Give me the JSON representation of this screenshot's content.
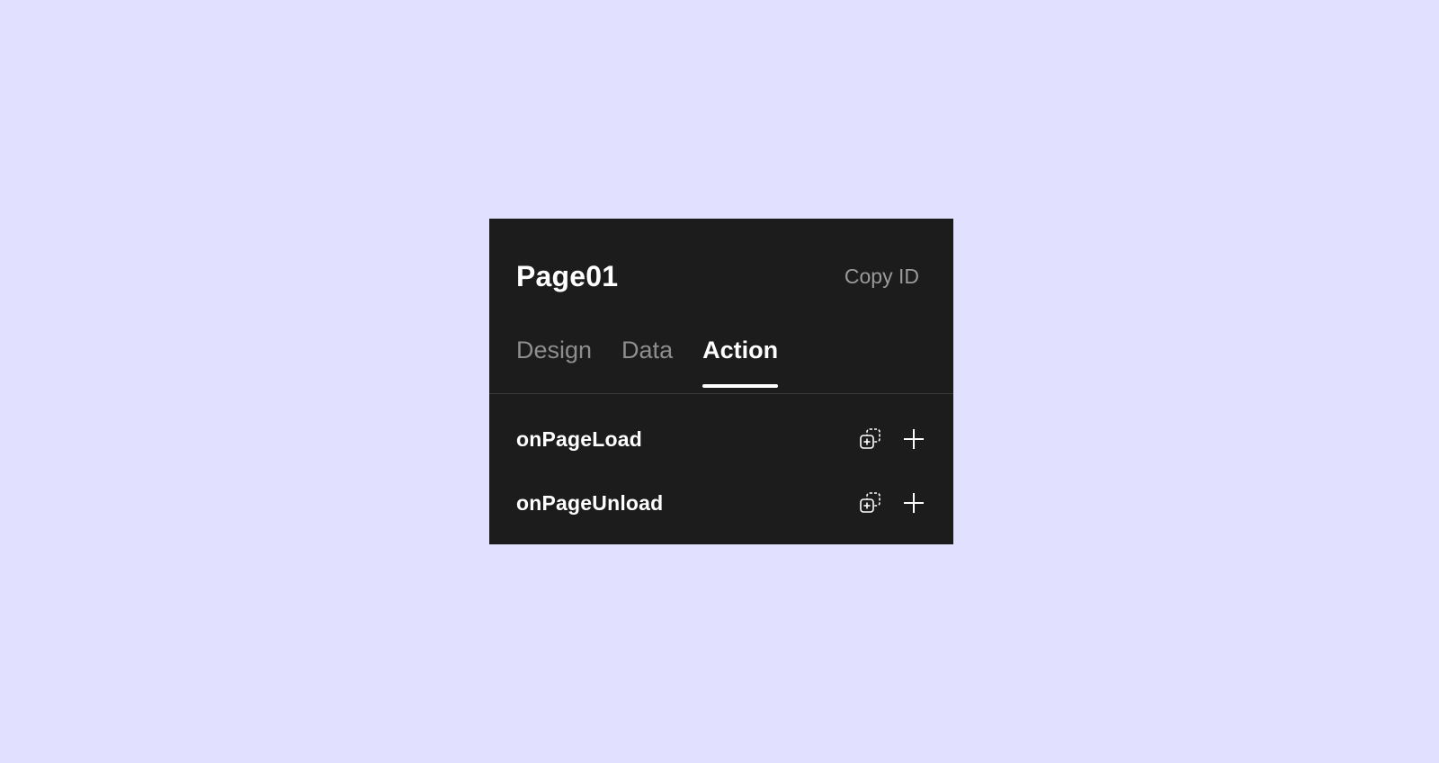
{
  "panel": {
    "title": "Page01",
    "copy_id_label": "Copy ID"
  },
  "tabs": [
    {
      "label": "Design",
      "active": false
    },
    {
      "label": "Data",
      "active": false
    },
    {
      "label": "Action",
      "active": true
    }
  ],
  "events": [
    {
      "label": "onPageLoad",
      "icons": [
        "add-copy-icon",
        "plus-icon"
      ]
    },
    {
      "label": "onPageUnload",
      "icons": [
        "add-copy-icon",
        "plus-icon"
      ]
    }
  ],
  "colors": {
    "background": "#e1e0ff",
    "panel": "#1c1c1c",
    "text_active": "#ffffff",
    "text_muted": "#8e8e8e"
  }
}
